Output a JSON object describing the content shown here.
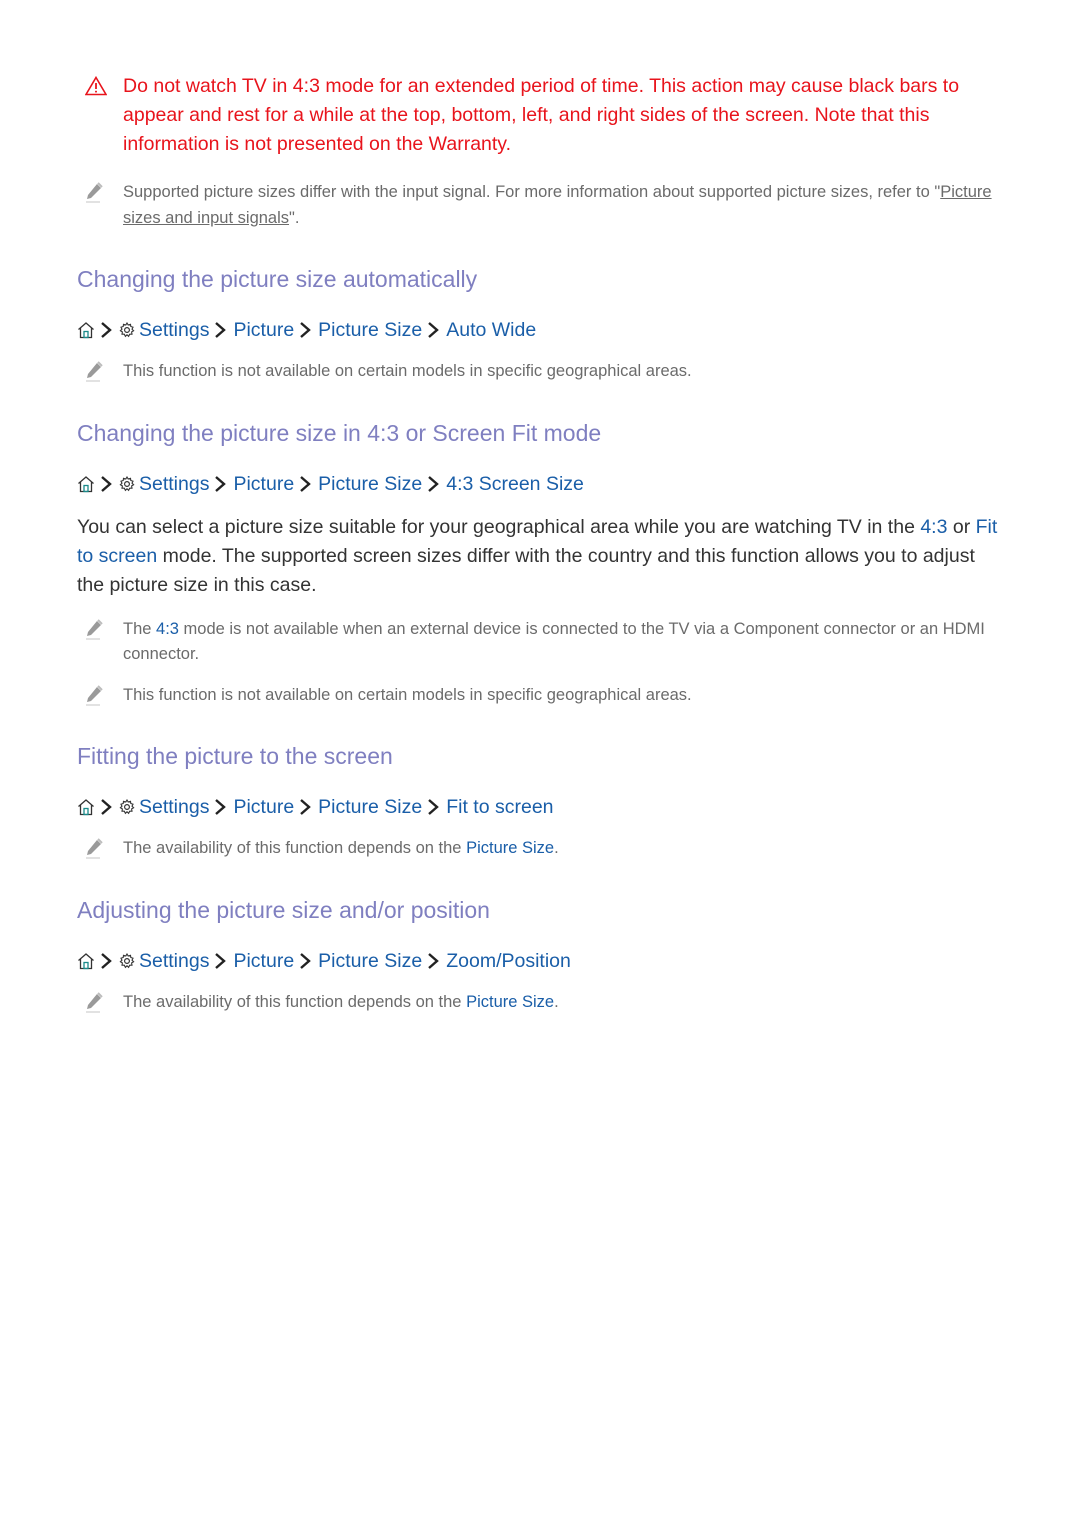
{
  "warning": {
    "icon": "warning-triangle-icon",
    "text": "Do not watch TV in 4:3 mode for an extended period of time. This action may cause black bars to appear and rest for a while at the top, bottom, left, and right sides of the screen. Note that this information is not presented on the Warranty."
  },
  "intro_note": {
    "icon": "pencil-note-icon",
    "text_before": "Supported picture sizes differ with the input signal. For more information about supported picture sizes, refer to \"",
    "link": "Picture sizes and input signals",
    "text_after": "\"."
  },
  "breadcrumb_common": {
    "home_icon": "home-icon",
    "settings_icon": "gear-icon",
    "separator_icon": "chevron-right-icon",
    "settings": "Settings",
    "picture": "Picture",
    "picture_size": "Picture Size"
  },
  "sections": [
    {
      "title": "Changing the picture size automatically",
      "final_item": "Auto Wide",
      "notes": [
        "This function is not available on certain models in specific geographical areas."
      ]
    },
    {
      "title": "Changing the picture size in 4:3 or Screen Fit mode",
      "final_item": "4:3 Screen Size",
      "body": {
        "part1": "You can select a picture size suitable for your geographical area while you are watching TV in the ",
        "hl1": "4:3",
        "part2": " or ",
        "hl2": "Fit to screen",
        "part3": " mode. The supported screen sizes differ with the country and this function allows you to adjust the picture size in this case."
      },
      "note1": {
        "before": "The ",
        "hl": "4:3",
        "after": " mode is not available when an external device is connected to the TV via a Component connector or an HDMI connector."
      },
      "note2": "This function is not available on certain models in specific geographical areas."
    },
    {
      "title": "Fitting the picture to the screen",
      "final_item": "Fit to screen",
      "note": {
        "before": "The availability of this function depends on the ",
        "hl": "Picture Size",
        "after": "."
      }
    },
    {
      "title": "Adjusting the picture size and/or position",
      "final_item": "Zoom/Position",
      "note": {
        "before": "The availability of this function depends on the ",
        "hl": "Picture Size",
        "after": "."
      }
    }
  ],
  "colors": {
    "warning": "#e8141c",
    "heading": "#7f7fc0",
    "link_blue": "#1a5ea8",
    "note_gray": "#6b6b6b",
    "body": "#333333"
  }
}
